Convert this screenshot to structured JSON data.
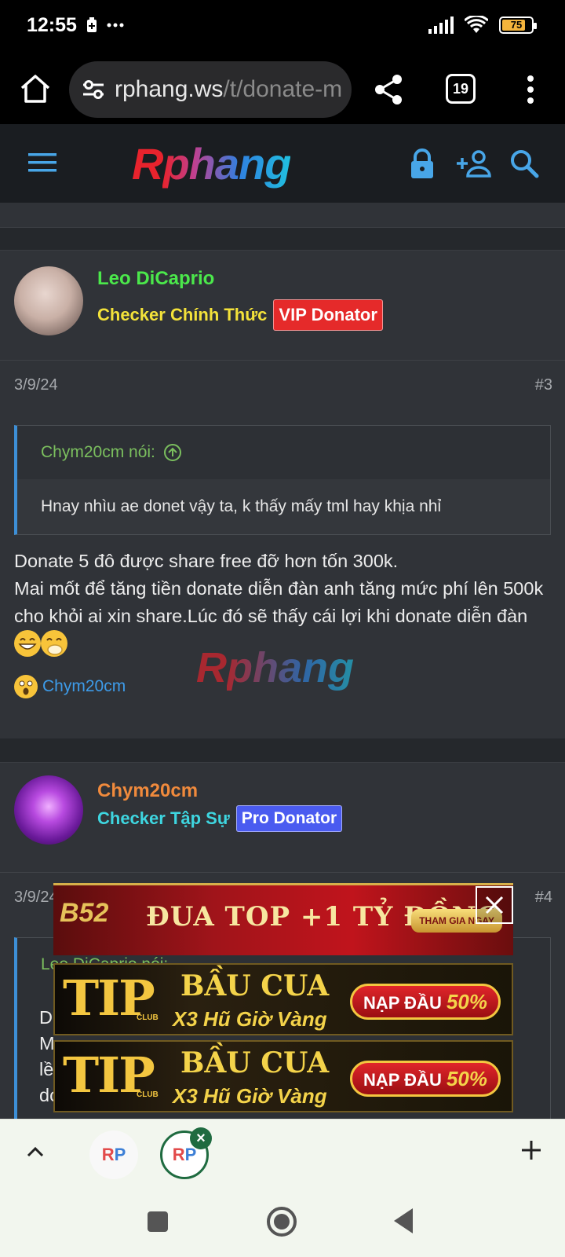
{
  "status_bar": {
    "time": "12:55",
    "battery": "75"
  },
  "browser": {
    "url_host": "rphang.ws",
    "url_path": "/t/donate-m",
    "tab_count": "19"
  },
  "site": {
    "logo_r": "R",
    "logo_rest": "phang"
  },
  "posts": [
    {
      "username": "Leo DiCaprio",
      "username_color": "#4be84b",
      "user_title": "Checker Chính Thức",
      "user_title_color": "#f3e23a",
      "badge": "VIP Donator",
      "badge_color": "#e52a2a",
      "date": "3/9/24",
      "number": "#3",
      "quote_author": "Chym20cm nói:",
      "quote_text": "Hnay nhìu ae donet vậy ta, k thấy mấy tml hay khịa nhỉ",
      "body_lines": [
        "Donate 5 đô được share free đỡ hơn tốn 300k.",
        "Mai mốt để tăng tiền donate diễn đàn anh tăng mức phí lên 500k cho khỏi ai xin share.Lúc đó sẽ thấy cái lợi khi donate diễn đàn"
      ],
      "reaction_user": "Chym20cm"
    },
    {
      "username": "Chym20cm",
      "username_color": "#f08a3c",
      "user_title": "Checker Tập Sự",
      "user_title_color": "#3ed6e0",
      "badge": "Pro Donator",
      "badge_color": "#4a5bf0",
      "date": "3/9/24",
      "number": "#4",
      "quote_author": "Leo DiCaprio nói:",
      "body_lines": [
        "D",
        "M",
        "lề",
        "dc"
      ]
    }
  ],
  "ads": {
    "b52": {
      "logo": "B52",
      "text": "ĐUA TOP +1 TỶ ĐỒNG",
      "button": "THAM GIA NGAY"
    },
    "tip": {
      "logo": "TIP",
      "club": "CLUB",
      "title": "BẦU CUA",
      "subtitle": "X3 Hũ Giờ Vàng",
      "button": "NẠP ĐẦU",
      "percent": "50%"
    }
  },
  "tab_strip": {
    "chip_label_r": "R",
    "chip_label_p": "P"
  },
  "icons": [
    "home-icon",
    "site-settings-icon",
    "share-icon",
    "more-vert-icon",
    "hamburger-icon",
    "lock-icon",
    "add-user-icon",
    "search-icon",
    "close-icon",
    "chevron-up-icon",
    "plus-icon"
  ]
}
